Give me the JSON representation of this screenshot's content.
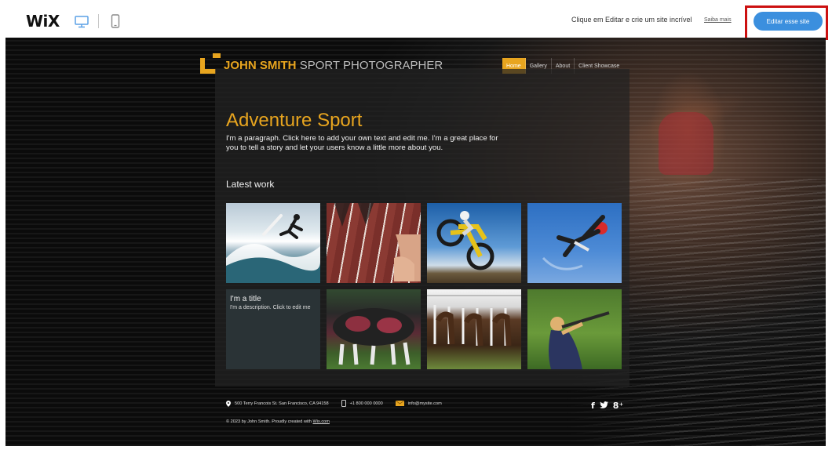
{
  "editor": {
    "logo": "WiX",
    "message": "Clique em Editar e crie um site incrível",
    "learn_more": "Saiba mais",
    "edit_button": "Editar esse site",
    "accent": "#3b8fde",
    "highlight_color": "#cc1010",
    "icons": [
      "desktop-icon",
      "mobile-icon"
    ]
  },
  "site": {
    "name_bold": "JOHN SMITH",
    "name_light": "SPORT PHOTOGRAPHER",
    "accent": "#e8a51f",
    "nav": [
      {
        "label": "Home",
        "active": true
      },
      {
        "label": "Gallery",
        "active": false
      },
      {
        "label": "About",
        "active": false
      },
      {
        "label": "Client Showcase",
        "active": false
      }
    ],
    "heading": "Adventure Sport",
    "paragraph": "I'm a paragraph. Click here to add your own text and edit me. I'm a great place for you to tell a story and let your users know a little more about you.",
    "latest": "Latest work",
    "gallery": [
      {
        "kind": "photo",
        "subject": "surfer"
      },
      {
        "kind": "photo",
        "subject": "sprinters-start"
      },
      {
        "kind": "photo",
        "subject": "motocross"
      },
      {
        "kind": "photo",
        "subject": "skydiver"
      },
      {
        "kind": "text",
        "title": "I'm a title",
        "description": "I'm a description. Click to edit me"
      },
      {
        "kind": "photo",
        "subject": "rugby-scrum"
      },
      {
        "kind": "photo",
        "subject": "horse-race"
      },
      {
        "kind": "photo",
        "subject": "clay-shooting"
      }
    ],
    "footer": {
      "address": "500 Terry Francois St. San Francisco, CA 94158",
      "phone": "+1 800 000 0000",
      "email": "info@mysite.com",
      "copyright_prefix": "© 2023 by John Smith. Proudly created with ",
      "copyright_link": "Wix.com",
      "social": [
        "f",
        "✦",
        "8⁺"
      ]
    }
  }
}
